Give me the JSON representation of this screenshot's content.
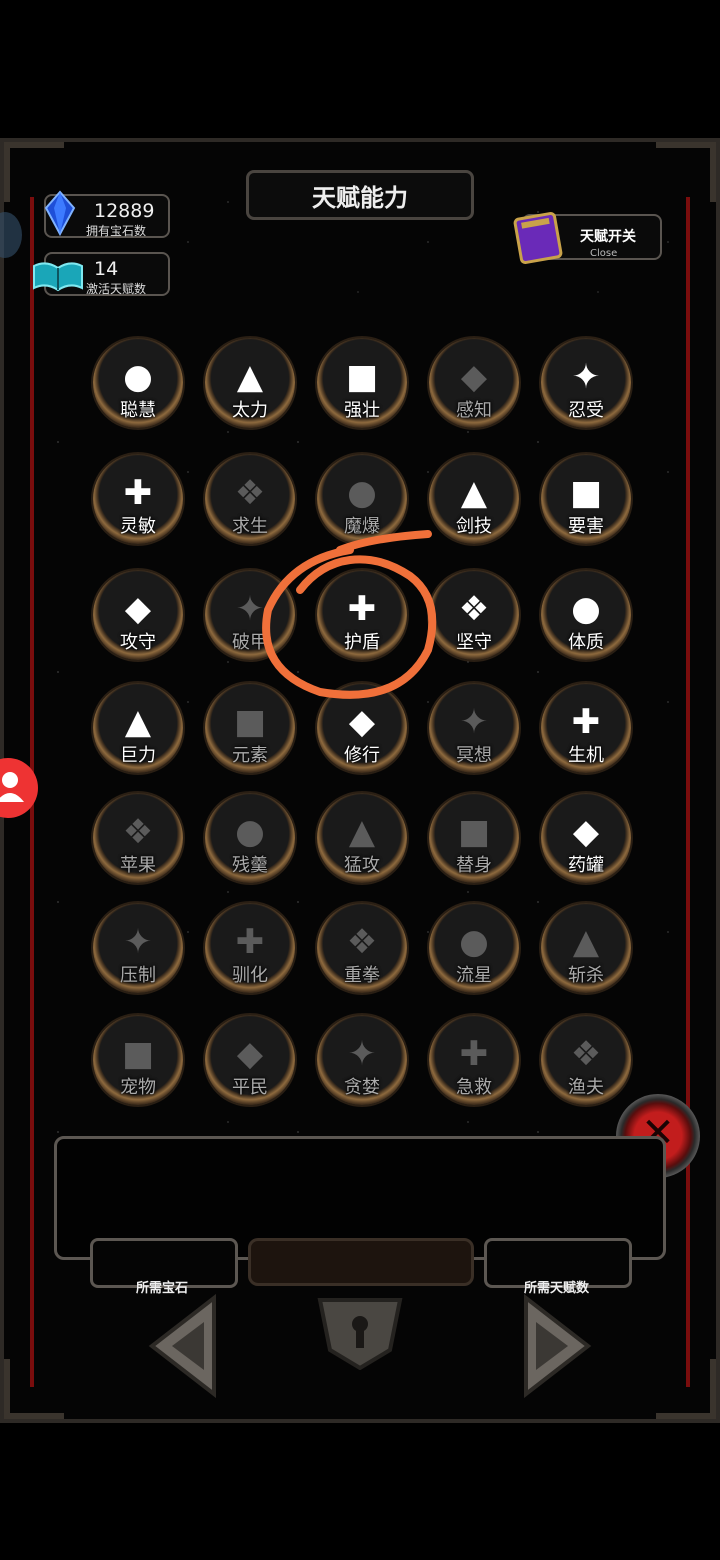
{
  "title": "天赋能力",
  "gems": {
    "value": "12889",
    "label": "拥有宝石数",
    "icon": "blue-gem-icon"
  },
  "active_talents": {
    "value": "14",
    "label": "激活天赋数",
    "icon": "open-book-icon"
  },
  "talent_toggle": {
    "label": "天赋开关",
    "sub": "Close",
    "icon": "purple-book-icon"
  },
  "talents": [
    {
      "name": "聪慧",
      "icon": "meditate-icon",
      "active": true
    },
    {
      "name": "太力",
      "icon": "strong-torso-icon",
      "active": true
    },
    {
      "name": "强壮",
      "icon": "muscle-man-icon",
      "active": true
    },
    {
      "name": "感知",
      "icon": "atom-eye-icon",
      "active": false
    },
    {
      "name": "忍受",
      "icon": "tentacle-icon",
      "active": true
    },
    {
      "name": "灵敏",
      "icon": "hooded-face-icon",
      "active": true
    },
    {
      "name": "求生",
      "icon": "running-man-icon",
      "active": false
    },
    {
      "name": "魔爆",
      "icon": "vortex-icon",
      "active": false
    },
    {
      "name": "剑技",
      "icon": "sword-icon",
      "active": true
    },
    {
      "name": "要害",
      "icon": "burst-icon",
      "active": true
    },
    {
      "name": "攻守",
      "icon": "knight-sword-icon",
      "active": true
    },
    {
      "name": "破甲",
      "icon": "broken-shield-icon",
      "active": false
    },
    {
      "name": "护盾",
      "icon": "hand-shield-icon",
      "active": true
    },
    {
      "name": "坚守",
      "icon": "tower-heart-icon",
      "active": true
    },
    {
      "name": "体质",
      "icon": "heart-shield-icon",
      "active": true
    },
    {
      "name": "巨力",
      "icon": "fist-icon",
      "active": true
    },
    {
      "name": "元素",
      "icon": "element-swirl-icon",
      "active": false
    },
    {
      "name": "修行",
      "icon": "meditating-figure-icon",
      "active": true
    },
    {
      "name": "冥想",
      "icon": "levitate-icon",
      "active": false
    },
    {
      "name": "生机",
      "icon": "sprout-icon",
      "active": true
    },
    {
      "name": "苹果",
      "icon": "apple-icon",
      "active": false
    },
    {
      "name": "残羹",
      "icon": "fish-bone-icon",
      "active": false
    },
    {
      "name": "猛攻",
      "icon": "crossed-swords-icon",
      "active": false
    },
    {
      "name": "替身",
      "icon": "puppet-icon",
      "active": false
    },
    {
      "name": "药罐",
      "icon": "pill-icon",
      "active": true
    },
    {
      "name": "压制",
      "icon": "demon-face-icon",
      "active": false
    },
    {
      "name": "驯化",
      "icon": "paw-icon",
      "active": false
    },
    {
      "name": "重拳",
      "icon": "punch-icon",
      "active": false
    },
    {
      "name": "流星",
      "icon": "meteor-icon",
      "active": false
    },
    {
      "name": "斩杀",
      "icon": "thumbs-down-icon",
      "active": false
    },
    {
      "name": "宠物",
      "icon": "bird-icon",
      "active": false
    },
    {
      "name": "平民",
      "icon": "farmer-icon",
      "active": false
    },
    {
      "name": "贪婪",
      "icon": "greedy-book-icon",
      "active": false
    },
    {
      "name": "急救",
      "icon": "first-aid-icon",
      "active": false
    },
    {
      "name": "渔夫",
      "icon": "fisherman-icon",
      "active": false
    }
  ],
  "required_gems_label": "所需宝石",
  "required_talents_label": "所需天赋数",
  "highlight": {
    "target": "护盾",
    "color": "#f0703a"
  }
}
